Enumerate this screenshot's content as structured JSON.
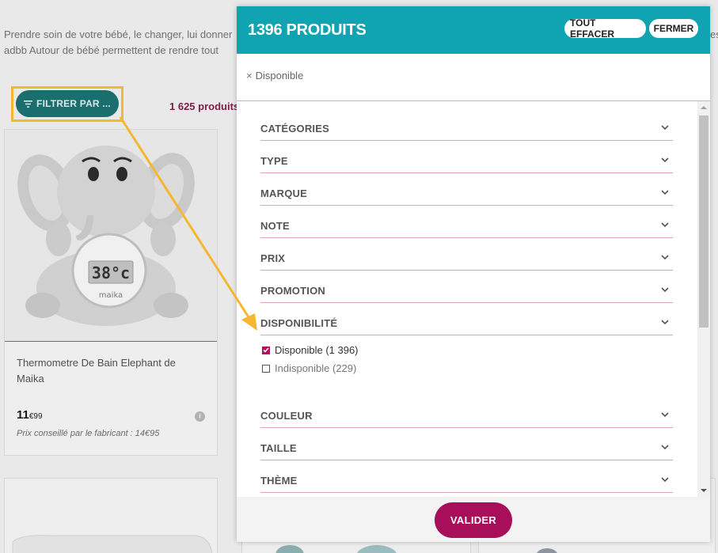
{
  "background": {
    "intro_line1": "Prendre soin de votre bébé, le changer, lui donner",
    "intro_line2": "adbb Autour de bébé permettent de rendre tout",
    "intro_right": "es",
    "filter_button_label": "FILTRER PAR ...",
    "product_count": "1 625 produits",
    "product": {
      "name": "Thermometre De Bain Elephant de Maika",
      "price_main": "11",
      "price_cents": "€99",
      "msrp": "Prix conseillé par le fabricant : 14€95",
      "thermo_display": "38°c",
      "thermo_brand": "maika"
    }
  },
  "panel": {
    "title": "1396 PRODUITS",
    "clear_all_label": "TOUT EFFACER",
    "close_label": "FERMER",
    "active_filter_remove": "×",
    "active_filter_label": "Disponible",
    "facets": [
      {
        "label": "CATÉGORIES"
      },
      {
        "label": "TYPE"
      },
      {
        "label": "MARQUE"
      },
      {
        "label": "NOTE"
      },
      {
        "label": "PRIX"
      },
      {
        "label": "PROMOTION"
      },
      {
        "label": "DISPONIBILITÉ"
      },
      {
        "label": "COULEUR"
      },
      {
        "label": "TAILLE"
      },
      {
        "label": "THÈME"
      }
    ],
    "availability_options": [
      {
        "label": "Disponible (1 396)",
        "checked": true
      },
      {
        "label": "Indisponible (229)",
        "checked": false
      }
    ],
    "validate_label": "VALIDER"
  },
  "colors": {
    "header_teal": "#10a4b2",
    "accent_magenta": "#a80f5b",
    "highlight_yellow": "#f5b730",
    "filter_button": "#1b6e6e"
  }
}
